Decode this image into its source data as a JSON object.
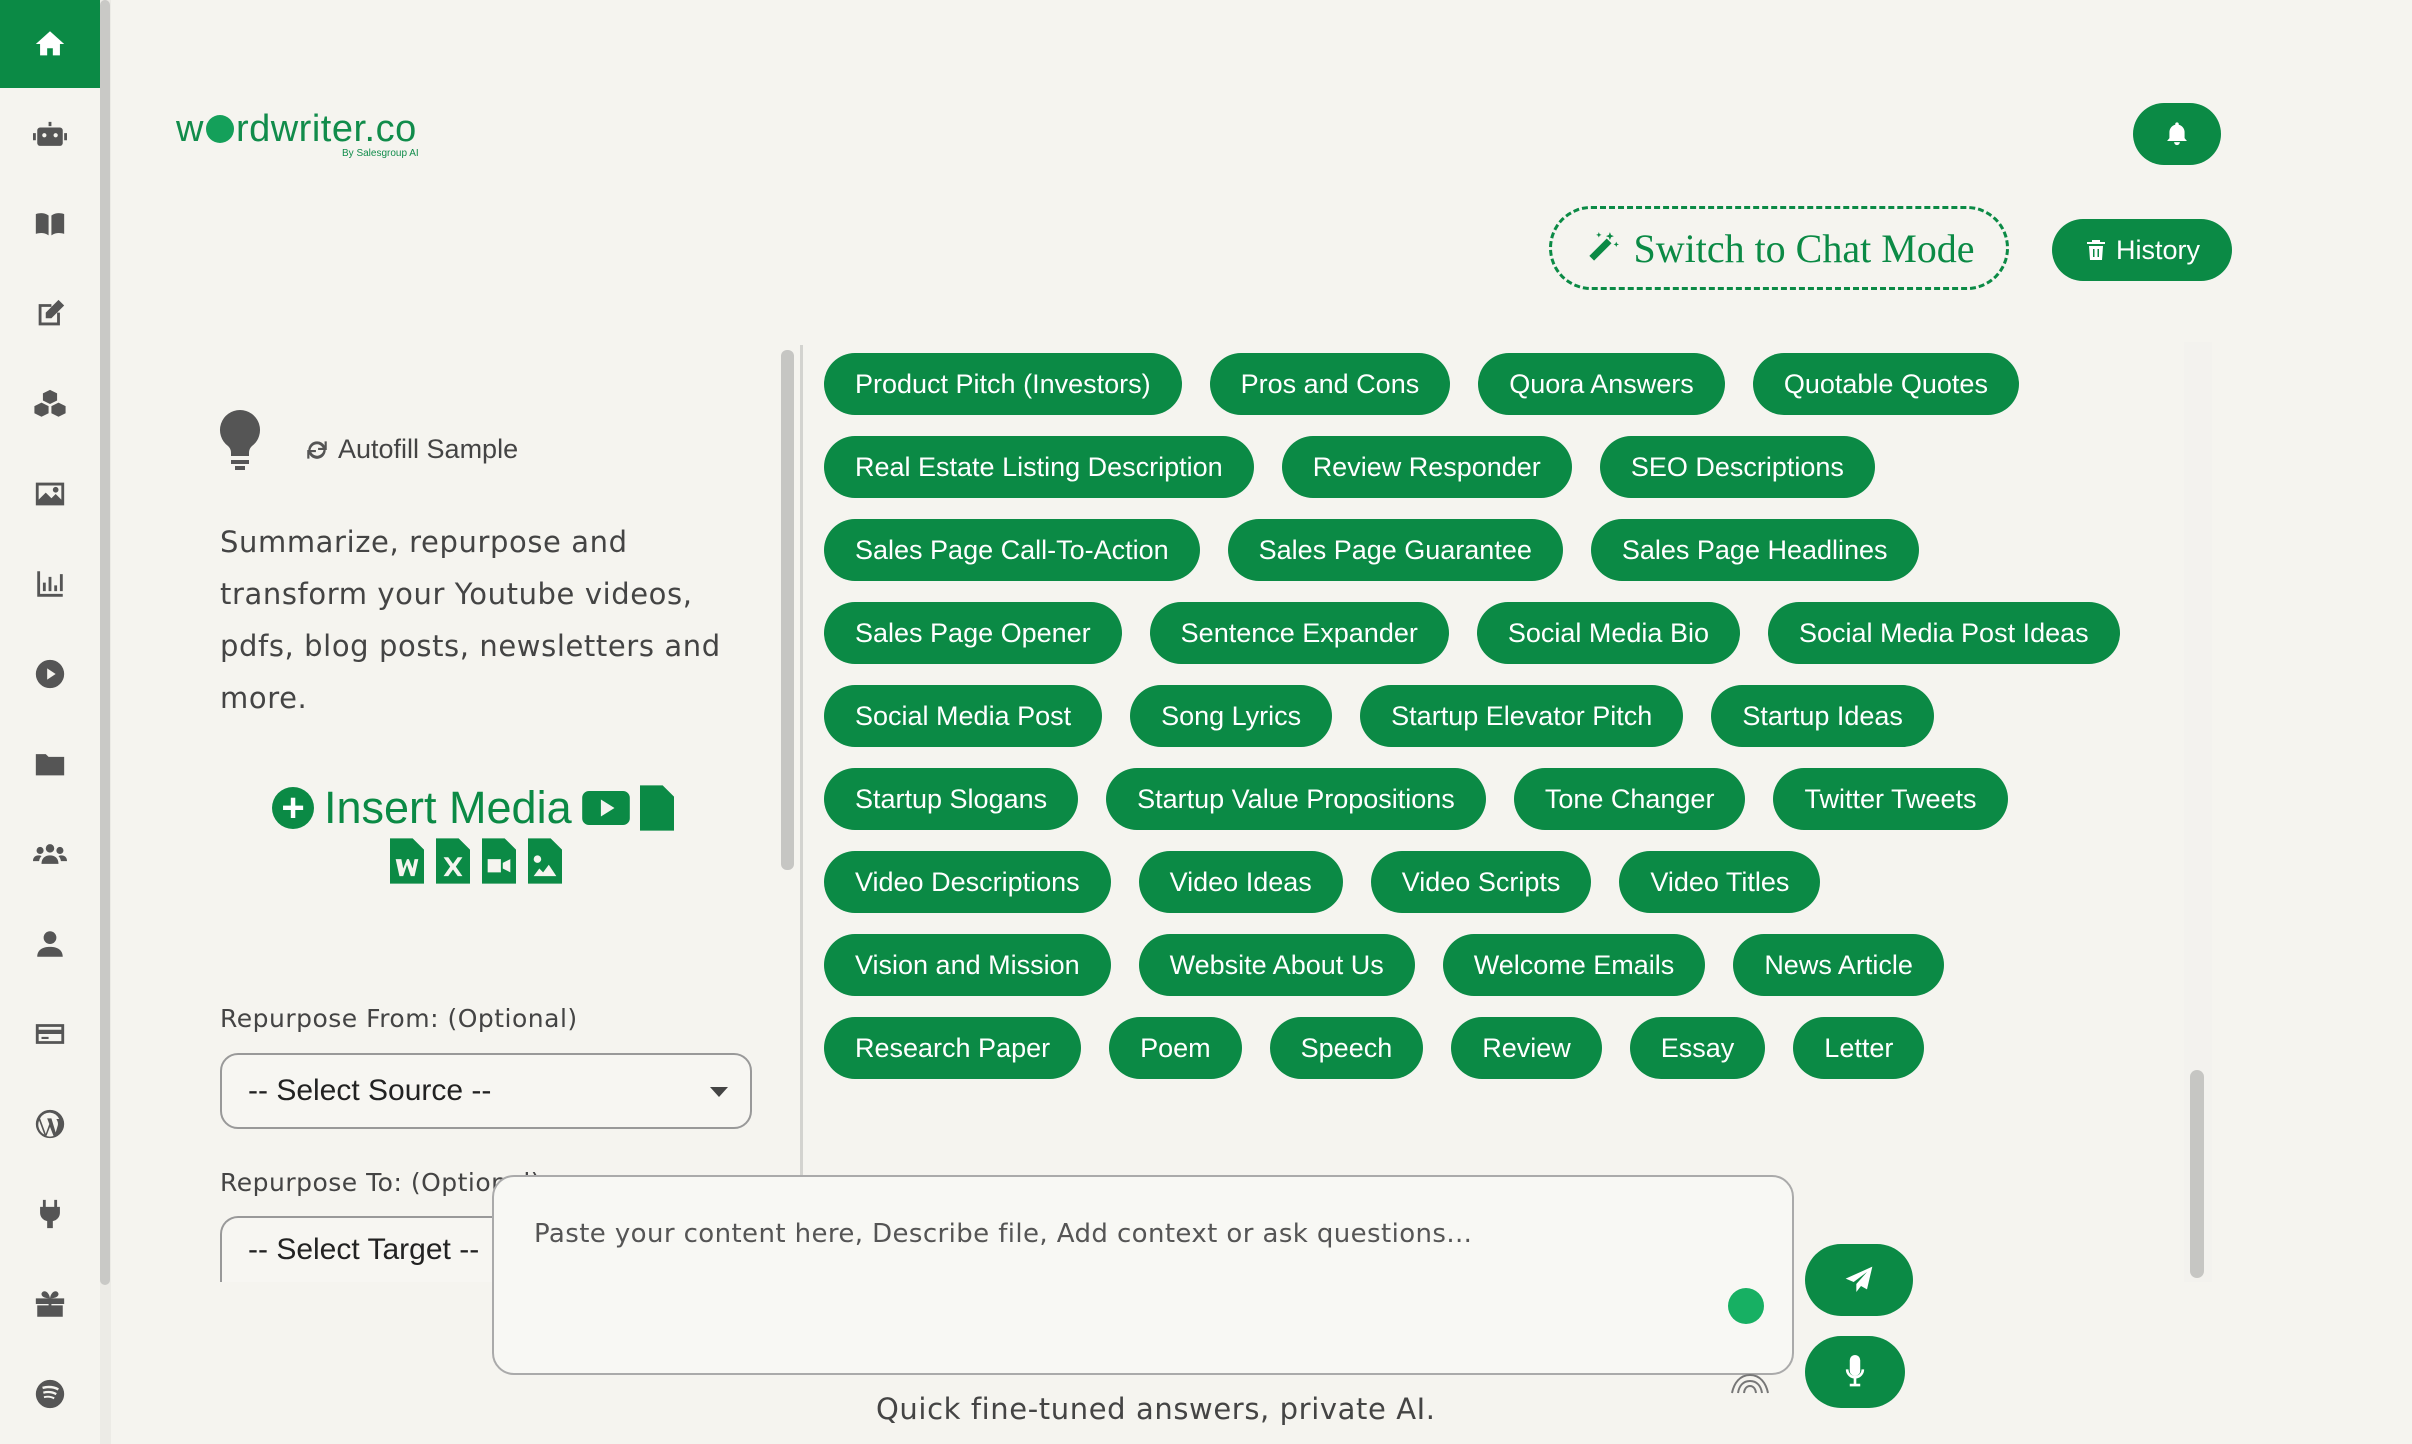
{
  "brand": {
    "logo_left": "w",
    "logo_right": "rdwriter.co",
    "byline": "By Salesgroup AI",
    "accent": "#0b8a45"
  },
  "sidebar": {
    "items": [
      {
        "name": "home-icon"
      },
      {
        "name": "robot-icon"
      },
      {
        "name": "book-icon"
      },
      {
        "name": "edit-icon"
      },
      {
        "name": "cubes-icon"
      },
      {
        "name": "image-icon"
      },
      {
        "name": "chart-icon"
      },
      {
        "name": "play-icon"
      },
      {
        "name": "folder-icon"
      },
      {
        "name": "users-icon"
      },
      {
        "name": "user-icon"
      },
      {
        "name": "credit-card-icon"
      },
      {
        "name": "wordpress-icon"
      },
      {
        "name": "plug-icon"
      },
      {
        "name": "gift-icon"
      },
      {
        "name": "spotify-icon"
      }
    ]
  },
  "header": {
    "chat_mode_label": "Switch to Chat Mode",
    "history_label": "History"
  },
  "left_panel": {
    "autofill_label": "Autofill Sample",
    "intro": "Summarize, repurpose and transform your Youtube videos, pdfs, blog posts, newsletters and more.",
    "insert_media_label": "Insert Media",
    "repurpose_from_label": "Repurpose From: (Optional)",
    "repurpose_from_value": "-- Select Source --",
    "repurpose_to_label": "Repurpose To: (Optional)",
    "repurpose_to_value": "-- Select Target --"
  },
  "tags": {
    "row1": [
      "Product Pitch (Investors)",
      "Pros and Cons",
      "Quora Answers",
      "Quotable Quotes"
    ],
    "row2": [
      "Real Estate Listing Description",
      "Review Responder",
      "SEO Descriptions"
    ],
    "row3": [
      "Sales Page Call-To-Action",
      "Sales Page Guarantee",
      "Sales Page Headlines"
    ],
    "row4": [
      "Sales Page Opener",
      "Sentence Expander",
      "Social Media Bio",
      "Social Media Post Ideas"
    ],
    "row5": [
      "Social Media Post",
      "Song Lyrics",
      "Startup Elevator Pitch",
      "Startup Ideas"
    ],
    "row6": [
      "Startup Slogans",
      "Startup Value Propositions",
      "Tone Changer",
      "Twitter Tweets"
    ],
    "row7": [
      "Video Descriptions",
      "Video Ideas",
      "Video Scripts",
      "Video Titles"
    ],
    "row8": [
      "Vision and Mission",
      "Website About Us",
      "Welcome Emails",
      "News Article"
    ],
    "row9": [
      "Research Paper",
      "Poem",
      "Speech",
      "Review",
      "Essay",
      "Letter"
    ]
  },
  "composer": {
    "placeholder": "Paste your content here, Describe file, Add context or ask questions...",
    "tagline": "Quick fine-tuned answers, private AI."
  }
}
